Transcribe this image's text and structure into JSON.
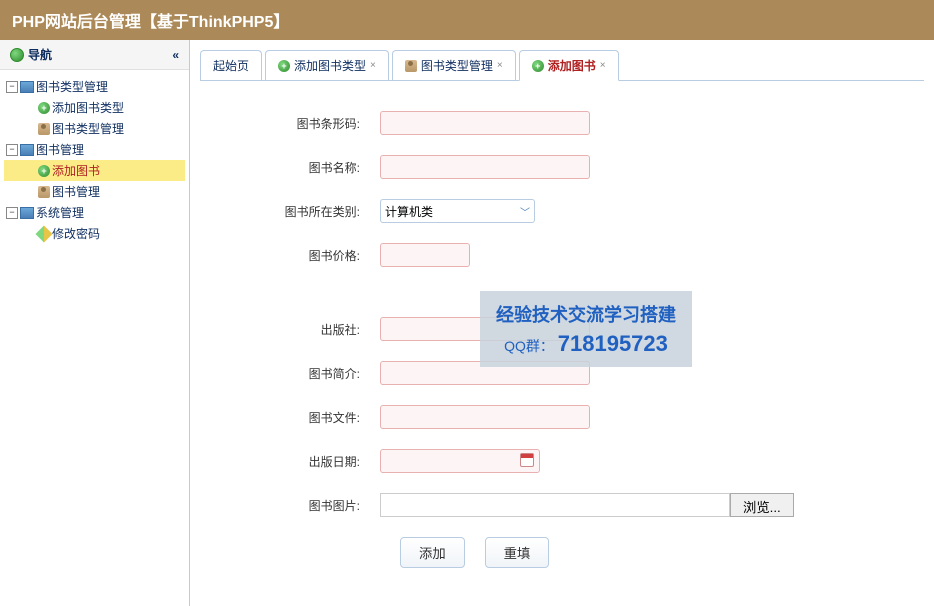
{
  "header": {
    "title": "PHP网站后台管理【基于ThinkPHP5】"
  },
  "sidebar": {
    "title": "导航",
    "nodes": [
      {
        "label": "图书类型管理",
        "level": 0,
        "expanded": true,
        "icon": "folder"
      },
      {
        "label": "添加图书类型",
        "level": 1,
        "icon": "plus"
      },
      {
        "label": "图书类型管理",
        "level": 1,
        "icon": "person"
      },
      {
        "label": "图书管理",
        "level": 0,
        "expanded": true,
        "icon": "folder"
      },
      {
        "label": "添加图书",
        "level": 1,
        "icon": "plus",
        "selected": true
      },
      {
        "label": "图书管理",
        "level": 1,
        "icon": "person"
      },
      {
        "label": "系统管理",
        "level": 0,
        "expanded": true,
        "icon": "folder"
      },
      {
        "label": "修改密码",
        "level": 1,
        "icon": "pencil"
      }
    ]
  },
  "tabs": [
    {
      "label": "起始页",
      "icon": null,
      "closable": false
    },
    {
      "label": "添加图书类型",
      "icon": "plus",
      "closable": true
    },
    {
      "label": "图书类型管理",
      "icon": "person",
      "closable": true
    },
    {
      "label": "添加图书",
      "icon": "plus",
      "closable": true,
      "active": true
    }
  ],
  "form": {
    "fields": {
      "barcode": "图书条形码:",
      "name": "图书名称:",
      "category": "图书所在类别:",
      "price": "图书价格:",
      "publisher": "出版社:",
      "summary": "图书简介:",
      "file": "图书文件:",
      "pubdate": "出版日期:",
      "image": "图书图片:"
    },
    "category_value": "计算机类",
    "browse_btn": "浏览...",
    "submit": "添加",
    "reset": "重填"
  },
  "watermark": {
    "line1": "经验技术交流学习搭建",
    "line2_prefix": "QQ群：",
    "line2_number": "718195723"
  }
}
